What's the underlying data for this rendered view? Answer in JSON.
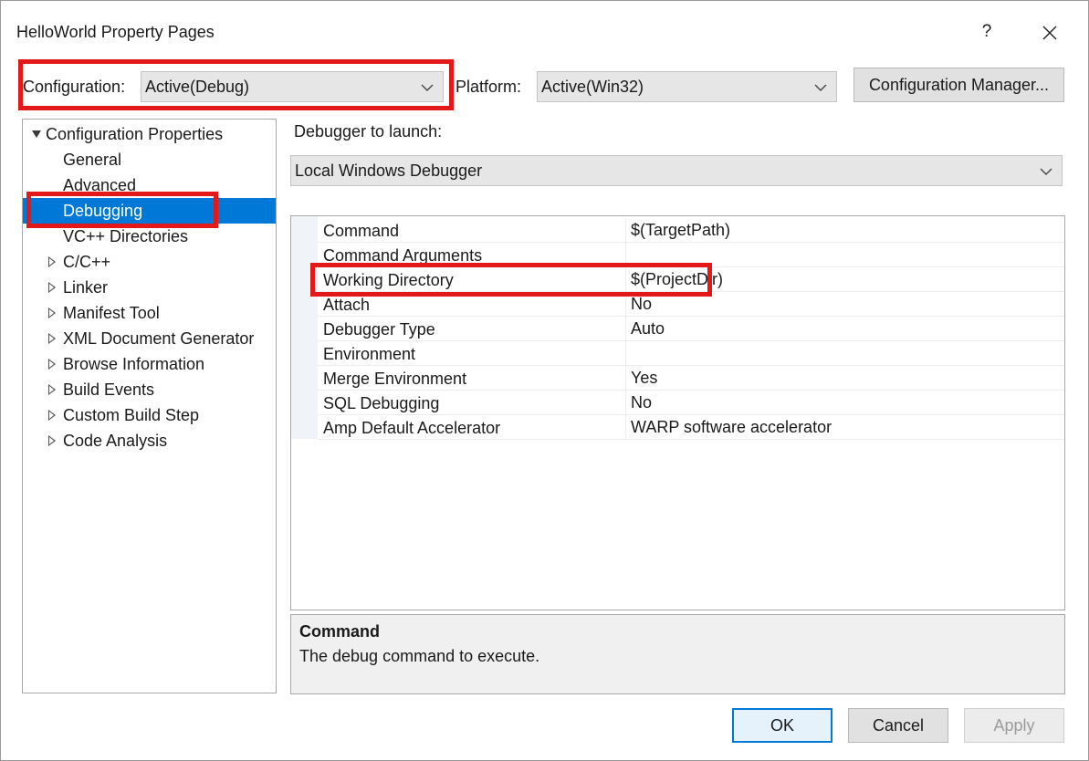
{
  "window": {
    "title": "HelloWorld Property Pages",
    "help_label": "?"
  },
  "toolbar": {
    "configuration_label": "Configuration:",
    "configuration_value": "Active(Debug)",
    "platform_label": "Platform:",
    "platform_value": "Active(Win32)",
    "config_manager_label": "Configuration Manager..."
  },
  "tree": {
    "root": "Configuration Properties",
    "items": [
      {
        "label": "General"
      },
      {
        "label": "Advanced"
      },
      {
        "label": "Debugging"
      },
      {
        "label": "VC++ Directories"
      },
      {
        "label": "C/C++"
      },
      {
        "label": "Linker"
      },
      {
        "label": "Manifest Tool"
      },
      {
        "label": "XML Document Generator"
      },
      {
        "label": "Browse Information"
      },
      {
        "label": "Build Events"
      },
      {
        "label": "Custom Build Step"
      },
      {
        "label": "Code Analysis"
      }
    ]
  },
  "debugger": {
    "launch_label": "Debugger to launch:",
    "launch_value": "Local Windows Debugger"
  },
  "properties": [
    {
      "name": "Command",
      "value": "$(TargetPath)"
    },
    {
      "name": "Command Arguments",
      "value": ""
    },
    {
      "name": "Working Directory",
      "value": "$(ProjectDir)"
    },
    {
      "name": "Attach",
      "value": "No"
    },
    {
      "name": "Debugger Type",
      "value": "Auto"
    },
    {
      "name": "Environment",
      "value": ""
    },
    {
      "name": "Merge Environment",
      "value": "Yes"
    },
    {
      "name": "SQL Debugging",
      "value": "No"
    },
    {
      "name": "Amp Default Accelerator",
      "value": "WARP software accelerator"
    }
  ],
  "description": {
    "title": "Command",
    "text": "The debug command to execute."
  },
  "buttons": {
    "ok": "OK",
    "cancel": "Cancel",
    "apply": "Apply"
  },
  "colors": {
    "selection": "#0078d7",
    "highlight_box": "#e31818"
  }
}
